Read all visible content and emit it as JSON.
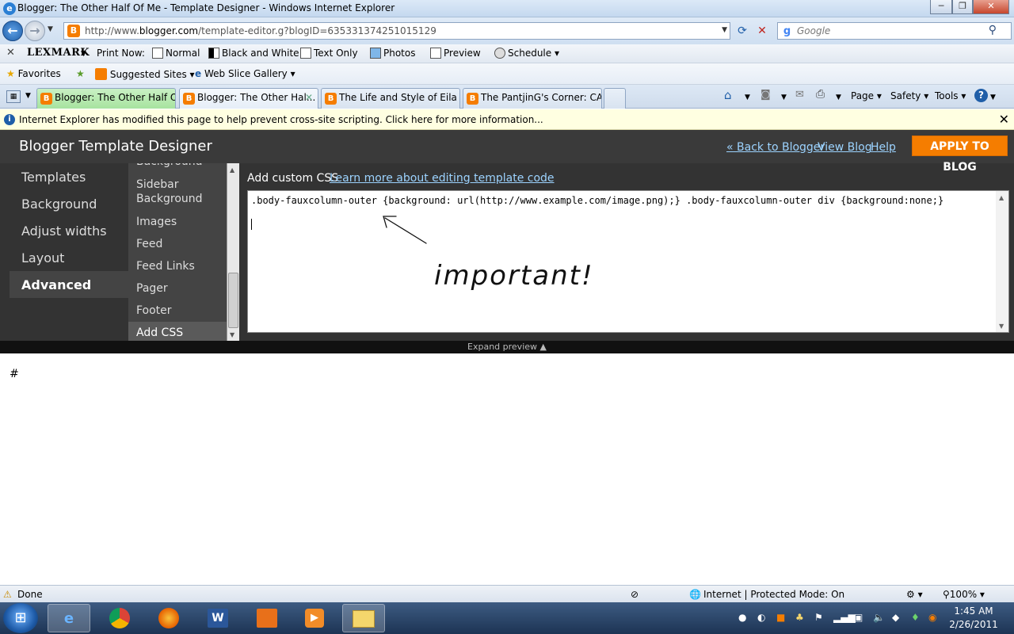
{
  "window": {
    "title": "Blogger: The Other Half Of Me - Template Designer - Windows Internet Explorer",
    "minimize": "─",
    "maximize": "❐",
    "close": "✕"
  },
  "address_bar": {
    "url_prefix": "http://www.",
    "url_domain": "blogger.com",
    "url_rest": "/template-editor.g?blogID=635331374251015129",
    "search_placeholder": "Google"
  },
  "lexmark_toolbar": {
    "brand": "LEXMARK",
    "print_now": "Print Now:",
    "normal": "Normal",
    "black_and_white": "Black and White",
    "text_only": "Text Only",
    "photos": "Photos",
    "preview": "Preview",
    "schedule": "Schedule"
  },
  "favorites_bar": {
    "favorites": "Favorites",
    "suggested_sites": "Suggested Sites",
    "web_slice_gallery": "Web Slice Gallery"
  },
  "tabs": [
    {
      "label": "Blogger: The Other Half Of..."
    },
    {
      "label": "Blogger: The Other Hal..."
    },
    {
      "label": "The Life and Style of Eila"
    },
    {
      "label": "The PantjinG's Corner: CA..."
    }
  ],
  "command_bar": {
    "page": "Page",
    "safety": "Safety",
    "tools": "Tools"
  },
  "info_bar": {
    "message": "Internet Explorer has modified this page to help prevent cross-site scripting.  Click here for more information..."
  },
  "designer": {
    "title": "Blogger Template Designer",
    "back_link": "« Back to Blogger",
    "view_blog": "View Blog",
    "help": "Help",
    "apply_button": "APPLY TO BLOG",
    "nav": [
      {
        "label": "Templates"
      },
      {
        "label": "Background"
      },
      {
        "label": "Adjust widths"
      },
      {
        "label": "Layout"
      },
      {
        "label": "Advanced"
      }
    ],
    "subnav": [
      {
        "label": "Background"
      },
      {
        "label": "Sidebar Background"
      },
      {
        "label": "Images"
      },
      {
        "label": "Feed"
      },
      {
        "label": "Feed Links"
      },
      {
        "label": "Pager"
      },
      {
        "label": "Footer"
      },
      {
        "label": "Add CSS"
      }
    ],
    "editor_label": "Add custom CSS",
    "editor_help_link": "Learn more about editing template code",
    "css_code": ".body-fauxcolumn-outer {background: url(http://www.example.com/image.png);} .body-fauxcolumn-outer div {background:none;}",
    "annotation": "important!",
    "expand_preview": "Expand preview"
  },
  "preview": {
    "content": "#"
  },
  "status_bar": {
    "done": "Done",
    "zone": "Internet | Protected Mode: On",
    "zoom": "100%"
  },
  "taskbar": {
    "time": "1:45 AM",
    "date": "2/26/2011"
  },
  "colors": {
    "accent_orange": "#f57d00",
    "designer_bg": "#333333",
    "link_blue": "#9cd3ff",
    "info_bar_bg": "#ffffe1"
  }
}
